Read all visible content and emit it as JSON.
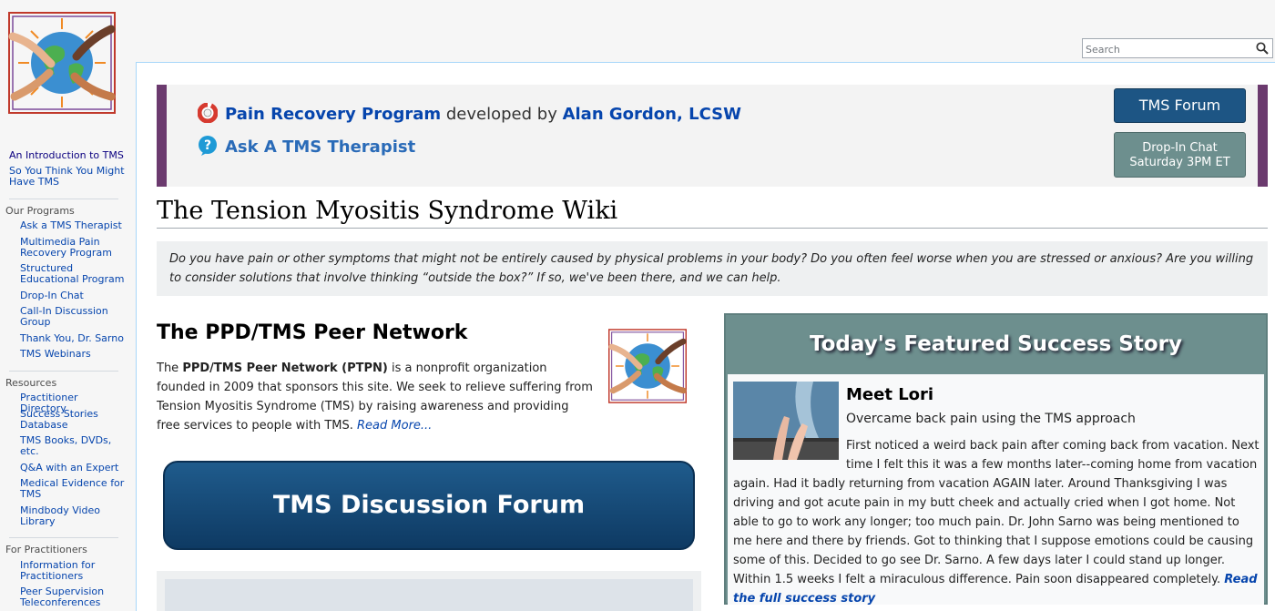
{
  "sidebar": {
    "intro_links": [
      {
        "label": "An Introduction to TMS"
      },
      {
        "label": "So You Think You Might Have TMS"
      }
    ],
    "sections": [
      {
        "heading": "Our Programs",
        "items": [
          "Ask a TMS Therapist",
          "Multimedia Pain Recovery Program",
          "Structured Educational Program",
          "Drop-In Chat",
          "Call-In Discussion Group",
          "Thank You, Dr. Sarno",
          "TMS Webinars"
        ]
      },
      {
        "heading": "Resources",
        "items": [
          "Practitioner Directory",
          "Success Stories Database",
          "TMS Books, DVDs, etc.",
          "Q&A with an Expert",
          "Medical Evidence for TMS",
          "Mindbody Video Library"
        ]
      },
      {
        "heading": "For Practitioners",
        "items": [
          "Information for Practitioners",
          "Peer Supervision Teleconferences"
        ]
      }
    ]
  },
  "search": {
    "placeholder": "Search"
  },
  "banner": {
    "program_link": "Pain Recovery Program",
    "developed_by": "developed by",
    "author_link": "Alan Gordon, LCSW",
    "therapist_link": "Ask A TMS Therapist",
    "forum_button": "TMS Forum",
    "chat_button_line1": "Drop-In Chat",
    "chat_button_line2": "Saturday 3PM ET"
  },
  "page": {
    "title": "The Tension Myositis Syndrome Wiki",
    "intro": "Do you have pain or other symptoms that might not be entirely caused by physical problems in your body? Do you often feel worse when you are stressed or anxious? Are you willing to consider solutions that involve thinking “outside the box?” If so, we've been there, and we can help."
  },
  "network": {
    "heading": "The PPD/TMS Peer Network",
    "body_prefix": "The ",
    "body_bold": "PPD/TMS Peer Network (PTPN)",
    "body_rest": " is a nonprofit organization founded in 2009 that sponsors this site. We seek to relieve suffering from Tension Myositis Syndrome (TMS) by raising awareness and providing free services to people with TMS. ",
    "read_more": "Read More...",
    "forum_banner": "TMS Discussion Forum"
  },
  "story": {
    "heading": "Today's Featured Success Story",
    "name": "Meet Lori",
    "subtitle": "Overcame back pain using the TMS approach",
    "text": "First noticed a weird back pain after coming back from vacation. Next time I felt this it was a few months later--coming home from vacation again. Had it badly returning from vacation AGAIN later. Around Thanksgiving I was driving and got acute pain in my butt cheek and actually cried when I got home. Not able to go to work any longer; too much pain. Dr. John Sarno was being mentioned to me here and there by friends. Got to thinking that I suppose emotions could be causing some of this. Decided to go see Dr. Sarno. A few days later I could stand up longer. Within 1.5 weeks I felt a miraculous difference. Pain soon disappeared completely. ",
    "read_link": "Read the full success story"
  },
  "colors": {
    "link": "#0645ad",
    "banner_border": "#6b3a6e",
    "forum_button": "#1d5584",
    "chat_button": "#6d8f8e"
  }
}
